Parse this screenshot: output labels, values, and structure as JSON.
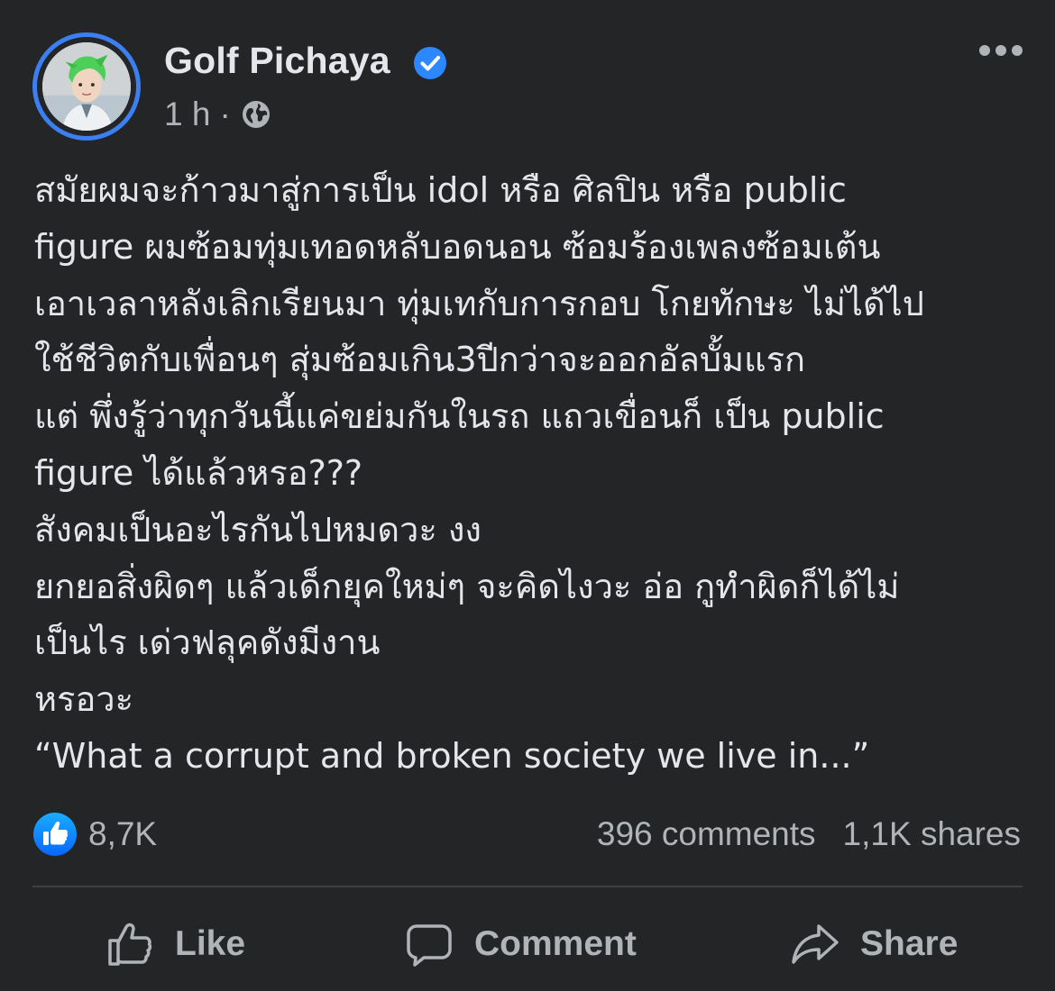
{
  "post": {
    "author": "Golf Pichaya",
    "time": "1 h",
    "separator": "·",
    "text": "สมัยผมจะก้าวมาสู่การเป็น idol หรือ ศิลปิน หรือ public\nfigure ผมซ้อมทุ่มเทอดหลับอดนอน ซ้อมร้องเพลงซ้อมเต้น\nเอาเวลาหลังเลิกเรียนมา ทุ่มเทกับการกอบ โกยทักษะ ไม่ได้ไป\nใช้ชีวิตกับเพื่อนๆ สุ่มซ้อมเกิน3ปีกว่าจะออกอัลบั้มแรก\nแต่ พึ่งรู้ว่าทุกวันนี้แค่ขย่มกันในรถ แถวเขื่อนก็ เป็น public\nfigure ได้แล้วหรอ???\nสังคมเป็นอะไรกันไปหมดวะ งง\nยกยอสิ่งผิดๆ แล้วเด็กยุคใหม่ๆ จะคิดไงวะ อ่อ กูทำผิดก็ได้ไม่\nเป็นไร เด่วฟลุคดังมีงาน\nหรอวะ\n“What a corrupt and broken society we live in...”"
  },
  "stats": {
    "reactions": "8,7K",
    "comments": "396 comments",
    "shares": "1,1K shares"
  },
  "actions": {
    "like": "Like",
    "comment": "Comment",
    "share": "Share"
  },
  "colors": {
    "background": "#242526",
    "accent": "#2d88ff",
    "text": "#e4e6eb",
    "secondary_text": "#b0b3b8"
  },
  "icons": [
    "verified-badge-icon",
    "globe-icon",
    "more-options-icon",
    "like-reaction-icon",
    "thumbs-up-icon",
    "comment-bubble-icon",
    "share-arrow-icon"
  ]
}
